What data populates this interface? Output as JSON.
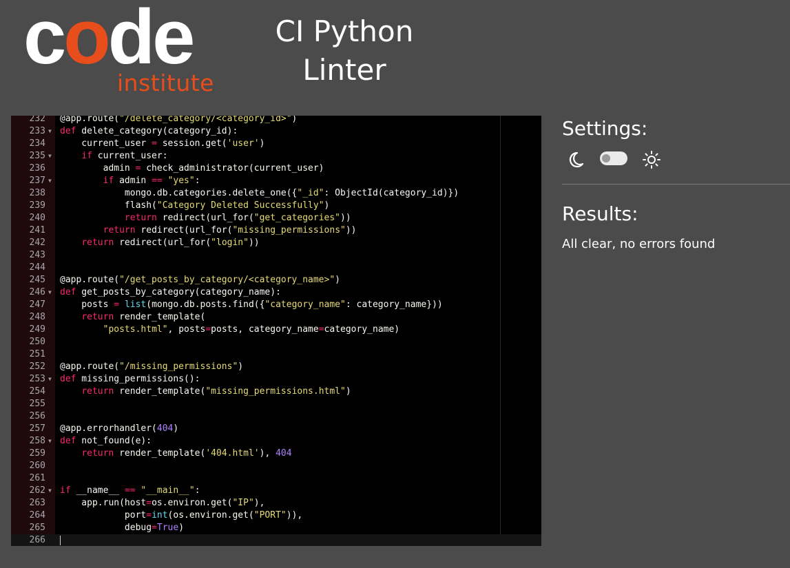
{
  "brand": {
    "logo_letters_before": "c",
    "logo_accent_letter": "o",
    "logo_letters_after": "de",
    "logo_subword": "institute",
    "colors": {
      "accent": "#e84e1b",
      "text": "#ffffff",
      "background": "#4b4b4b"
    }
  },
  "header": {
    "title_line1": "CI Python",
    "title_line2": "Linter"
  },
  "editor": {
    "lines": [
      {
        "num": "232",
        "fold": false,
        "segs": [
          [
            "t",
            "@app.route("
          ],
          [
            "s",
            "\"/delete_category/<category_id>\""
          ],
          [
            "t",
            ")"
          ]
        ]
      },
      {
        "num": "233",
        "fold": true,
        "segs": [
          [
            "k",
            "def"
          ],
          [
            "t",
            " delete_category(category_id):"
          ]
        ]
      },
      {
        "num": "234",
        "fold": false,
        "segs": [
          [
            "t",
            "    current_user "
          ],
          [
            "k",
            "="
          ],
          [
            "t",
            " session.get("
          ],
          [
            "s",
            "'user'"
          ],
          [
            "t",
            ")"
          ]
        ]
      },
      {
        "num": "235",
        "fold": true,
        "segs": [
          [
            "t",
            "    "
          ],
          [
            "k",
            "if"
          ],
          [
            "t",
            " current_user:"
          ]
        ]
      },
      {
        "num": "236",
        "fold": false,
        "segs": [
          [
            "t",
            "        admin "
          ],
          [
            "k",
            "="
          ],
          [
            "t",
            " check_administrator(current_user)"
          ]
        ]
      },
      {
        "num": "237",
        "fold": true,
        "segs": [
          [
            "t",
            "        "
          ],
          [
            "k",
            "if"
          ],
          [
            "t",
            " admin "
          ],
          [
            "k",
            "=="
          ],
          [
            "t",
            " "
          ],
          [
            "s",
            "\"yes\""
          ],
          [
            "t",
            ":"
          ]
        ]
      },
      {
        "num": "238",
        "fold": false,
        "segs": [
          [
            "t",
            "            mongo.db.categories.delete_one({"
          ],
          [
            "s",
            "\"_id\""
          ],
          [
            "t",
            ": ObjectId(category_id)})"
          ]
        ]
      },
      {
        "num": "239",
        "fold": false,
        "segs": [
          [
            "t",
            "            flash("
          ],
          [
            "s",
            "\"Category Deleted Successfully\""
          ],
          [
            "t",
            ")"
          ]
        ]
      },
      {
        "num": "240",
        "fold": false,
        "segs": [
          [
            "t",
            "            "
          ],
          [
            "k",
            "return"
          ],
          [
            "t",
            " redirect(url_for("
          ],
          [
            "s",
            "\"get_categories\""
          ],
          [
            "t",
            "))"
          ]
        ]
      },
      {
        "num": "241",
        "fold": false,
        "segs": [
          [
            "t",
            "        "
          ],
          [
            "k",
            "return"
          ],
          [
            "t",
            " redirect(url_for("
          ],
          [
            "s",
            "\"missing_permissions\""
          ],
          [
            "t",
            "))"
          ]
        ]
      },
      {
        "num": "242",
        "fold": false,
        "segs": [
          [
            "t",
            "    "
          ],
          [
            "k",
            "return"
          ],
          [
            "t",
            " redirect(url_for("
          ],
          [
            "s",
            "\"login\""
          ],
          [
            "t",
            "))"
          ]
        ]
      },
      {
        "num": "243",
        "fold": false,
        "segs": []
      },
      {
        "num": "244",
        "fold": false,
        "segs": []
      },
      {
        "num": "245",
        "fold": false,
        "segs": [
          [
            "t",
            "@app.route("
          ],
          [
            "s",
            "\"/get_posts_by_category/<category_name>\""
          ],
          [
            "t",
            ")"
          ]
        ]
      },
      {
        "num": "246",
        "fold": true,
        "segs": [
          [
            "k",
            "def"
          ],
          [
            "t",
            " get_posts_by_category(category_name):"
          ]
        ]
      },
      {
        "num": "247",
        "fold": false,
        "segs": [
          [
            "t",
            "    posts "
          ],
          [
            "k",
            "="
          ],
          [
            "t",
            " "
          ],
          [
            "b",
            "list"
          ],
          [
            "t",
            "(mongo.db.posts.find({"
          ],
          [
            "s",
            "\"category_name\""
          ],
          [
            "t",
            ": category_name}))"
          ]
        ]
      },
      {
        "num": "248",
        "fold": false,
        "segs": [
          [
            "t",
            "    "
          ],
          [
            "k",
            "return"
          ],
          [
            "t",
            " render_template("
          ]
        ]
      },
      {
        "num": "249",
        "fold": false,
        "segs": [
          [
            "t",
            "        "
          ],
          [
            "s",
            "\"posts.html\""
          ],
          [
            "t",
            ", posts"
          ],
          [
            "k",
            "="
          ],
          [
            "t",
            "posts, category_name"
          ],
          [
            "k",
            "="
          ],
          [
            "t",
            "category_name)"
          ]
        ]
      },
      {
        "num": "250",
        "fold": false,
        "segs": []
      },
      {
        "num": "251",
        "fold": false,
        "segs": []
      },
      {
        "num": "252",
        "fold": false,
        "segs": [
          [
            "t",
            "@app.route("
          ],
          [
            "s",
            "\"/missing_permissions\""
          ],
          [
            "t",
            ")"
          ]
        ]
      },
      {
        "num": "253",
        "fold": true,
        "segs": [
          [
            "k",
            "def"
          ],
          [
            "t",
            " missing_permissions():"
          ]
        ]
      },
      {
        "num": "254",
        "fold": false,
        "segs": [
          [
            "t",
            "    "
          ],
          [
            "k",
            "return"
          ],
          [
            "t",
            " render_template("
          ],
          [
            "s",
            "\"missing_permissions.html\""
          ],
          [
            "t",
            ")"
          ]
        ]
      },
      {
        "num": "255",
        "fold": false,
        "segs": []
      },
      {
        "num": "256",
        "fold": false,
        "segs": []
      },
      {
        "num": "257",
        "fold": false,
        "segs": [
          [
            "t",
            "@app.errorhandler("
          ],
          [
            "n",
            "404"
          ],
          [
            "t",
            ")"
          ]
        ]
      },
      {
        "num": "258",
        "fold": true,
        "segs": [
          [
            "k",
            "def"
          ],
          [
            "t",
            " not_found(e):"
          ]
        ]
      },
      {
        "num": "259",
        "fold": false,
        "segs": [
          [
            "t",
            "    "
          ],
          [
            "k",
            "return"
          ],
          [
            "t",
            " render_template("
          ],
          [
            "s",
            "'404.html'"
          ],
          [
            "t",
            "), "
          ],
          [
            "n",
            "404"
          ]
        ]
      },
      {
        "num": "260",
        "fold": false,
        "segs": []
      },
      {
        "num": "261",
        "fold": false,
        "segs": []
      },
      {
        "num": "262",
        "fold": true,
        "segs": [
          [
            "k",
            "if"
          ],
          [
            "t",
            " __name__ "
          ],
          [
            "k",
            "=="
          ],
          [
            "t",
            " "
          ],
          [
            "s",
            "\"__main__\""
          ],
          [
            "t",
            ":"
          ]
        ]
      },
      {
        "num": "263",
        "fold": false,
        "segs": [
          [
            "t",
            "    app.run(host"
          ],
          [
            "k",
            "="
          ],
          [
            "t",
            "os.environ.get("
          ],
          [
            "s",
            "\"IP\""
          ],
          [
            "t",
            "),"
          ]
        ]
      },
      {
        "num": "264",
        "fold": false,
        "segs": [
          [
            "t",
            "            port"
          ],
          [
            "k",
            "="
          ],
          [
            "b",
            "int"
          ],
          [
            "t",
            "(os.environ.get("
          ],
          [
            "s",
            "\"PORT\""
          ],
          [
            "t",
            ")),"
          ]
        ]
      },
      {
        "num": "265",
        "fold": false,
        "segs": [
          [
            "t",
            "            debug"
          ],
          [
            "k",
            "="
          ],
          [
            "v",
            "True"
          ],
          [
            "t",
            ")"
          ]
        ]
      },
      {
        "num": "266",
        "fold": false,
        "segs": [],
        "active": true
      }
    ]
  },
  "settings": {
    "heading": "Settings:",
    "dark_icon": "moon-icon",
    "light_icon": "sun-icon",
    "toggle_state": "off"
  },
  "results": {
    "heading": "Results:",
    "message": "All clear, no errors found"
  }
}
